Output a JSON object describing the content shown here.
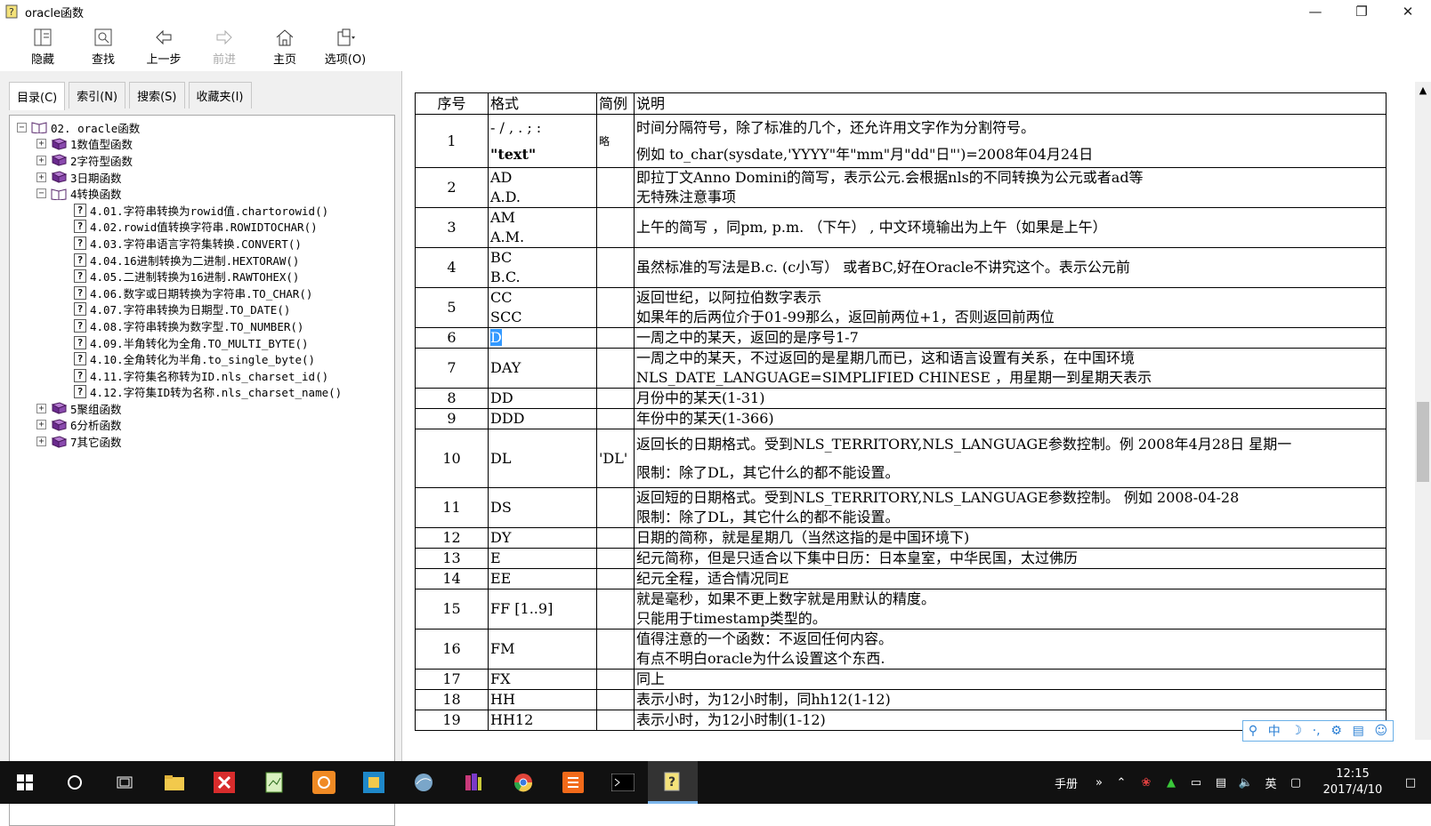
{
  "window": {
    "title": "oracle函数"
  },
  "toolbar": {
    "hide": "隐藏",
    "find": "查找",
    "back": "上一步",
    "forward": "前进",
    "home": "主页",
    "options": "选项(O)"
  },
  "tabs": {
    "contents": "目录(C)",
    "index": "索引(N)",
    "search": "搜索(S)",
    "favorites": "收藏夹(I)"
  },
  "tree": {
    "root": "02. oracle函数",
    "c1": "1数值型函数",
    "c2": "2字符型函数",
    "c3": "3日期函数",
    "c4": "4转换函数",
    "t401": "4.01.字符串转换为rowid值.chartorowid()",
    "t402": "4.02.rowid值转换字符串.ROWIDTOCHAR()",
    "t403": "4.03.字符串语言字符集转换.CONVERT()",
    "t404": "4.04.16进制转换为二进制.HEXTORAW()",
    "t405": "4.05.二进制转换为16进制.RAWTOHEX()",
    "t406": "4.06.数字或日期转换为字符串.TO_CHAR()",
    "t407": "4.07.字符串转换为日期型.TO_DATE()",
    "t408": "4.08.字符串转换为数字型.TO_NUMBER()",
    "t409": "4.09.半角转化为全角.TO_MULTI_BYTE()",
    "t410": "4.10.全角转化为半角.to_single_byte()",
    "t411": "4.11.字符集名称转为ID.nls_charset_id()",
    "t412": "4.12.字符集ID转为名称.nls_charset_name()",
    "c5": "5聚组函数",
    "c6": "6分析函数",
    "c7": "7其它函数"
  },
  "table": {
    "headers": {
      "no": "序号",
      "fmt": "格式",
      "ex": "简例",
      "desc": "说明"
    },
    "r1": {
      "no": "1",
      "f1": "- / , . ; :",
      "f2": "\"text\"",
      "ex": "略",
      "d1": "时间分隔符号，除了标准的几个，还允许用文字作为分割符号。",
      "d2": "例如 to_char(sysdate,'YYYY\"年\"mm\"月\"dd\"日\"')=2008年04月24日"
    },
    "r2": {
      "no": "2",
      "f1": "AD",
      "f2": "A.D.",
      "d1": "即拉丁文Anno Domini的简写，表示公元.会根据nls的不同转换为公元或者ad等",
      "d2": "无特殊注意事项"
    },
    "r3": {
      "no": "3",
      "f1": "AM",
      "f2": "A.M.",
      "d1": "上午的简写 ，同pm, p.m. （下午） , 中文环境输出为上午（如果是上午）"
    },
    "r4": {
      "no": "4",
      "f1": "BC",
      "f2": "B.C.",
      "d1": "虽然标准的写法是B.c. (c小写） 或者BC,好在Oracle不讲究这个。表示公元前"
    },
    "r5": {
      "no": "5",
      "f1": "CC",
      "f2": "SCC",
      "d1": "返回世纪，以阿拉伯数字表示",
      "d2": "如果年的后两位介于01-99那么，返回前两位+1，否则返回前两位"
    },
    "r6": {
      "no": "6",
      "f1": "D",
      "d1": "一周之中的某天，返回的是序号1-7"
    },
    "r7": {
      "no": "7",
      "f1": "DAY",
      "d1": "一周之中的某天，不过返回的是星期几而已，这和语言设置有关系，在中国环境",
      "d2": "NLS_DATE_LANGUAGE=SIMPLIFIED CHINESE ，用星期一到星期天表示"
    },
    "r8": {
      "no": "8",
      "f1": "DD",
      "d1": "月份中的某天(1-31)"
    },
    "r9": {
      "no": "9",
      "f1": "DDD",
      "d1": "年份中的某天(1-366)"
    },
    "r10": {
      "no": "10",
      "f1": "DL",
      "ex": "'DL'",
      "d1": "返回长的日期格式。受到NLS_TERRITORY,NLS_LANGUAGE参数控制。例 2008年4月28日 星期一",
      "d2": "限制：除了DL，其它什么的都不能设置。"
    },
    "r11": {
      "no": "11",
      "f1": "DS",
      "d1": "返回短的日期格式。受到NLS_TERRITORY,NLS_LANGUAGE参数控制。 例如 2008-04-28",
      "d2": "限制：除了DL，其它什么的都不能设置。"
    },
    "r12": {
      "no": "12",
      "f1": "DY",
      "d1": "日期的简称，就是星期几（当然这指的是中国环境下)"
    },
    "r13": {
      "no": "13",
      "f1": "E",
      "d1": "纪元简称，但是只适合以下集中日历：日本皇室，中华民国，太过佛历"
    },
    "r14": {
      "no": "14",
      "f1": "EE",
      "d1": "纪元全程，适合情况同E"
    },
    "r15": {
      "no": "15",
      "f1": "FF [1..9]",
      "d1": "就是毫秒，如果不更上数字就是用默认的精度。",
      "d2": "只能用于timestamp类型的。"
    },
    "r16": {
      "no": "16",
      "f1": "FM",
      "d1": "值得注意的一个函数：不返回任何内容。",
      "d2": "有点不明白oracle为什么设置这个东西."
    },
    "r17": {
      "no": "17",
      "f1": "FX",
      "d1": "同上"
    },
    "r18": {
      "no": "18",
      "f1": "HH",
      "d1": "表示小时，为12小时制，同hh12(1-12)"
    },
    "r19": {
      "no": "19",
      "f1": "HH12",
      "d1": "表示小时，为12小时制(1-12)"
    }
  },
  "taskbar": {
    "handbook": "手册",
    "lang": "英",
    "time": "12:15",
    "date": "2017/4/10"
  }
}
